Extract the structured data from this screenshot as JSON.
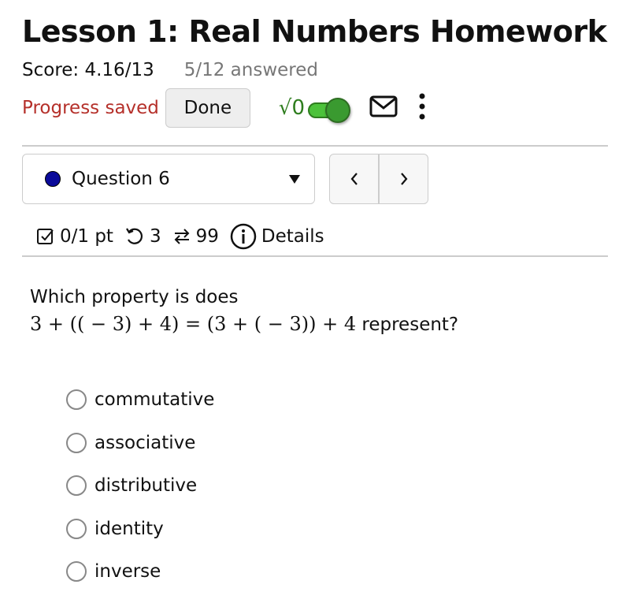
{
  "header": {
    "title": "Lesson 1: Real Numbers Homework",
    "score": "Score: 4.16/13",
    "answered": "5/12 answered",
    "progress_status": "Progress saved",
    "done_label": "Done",
    "math_toggle_label": "√0",
    "math_toggle_on": true
  },
  "question_nav": {
    "selected": "Question 6",
    "status_color": "#0a0a9a",
    "prev_label": "‹",
    "next_label": "›"
  },
  "meta": {
    "points": "0/1 pt",
    "retries": "3",
    "attempts": "99",
    "details_label": "Details"
  },
  "question": {
    "prompt": "Which property is does",
    "expression": "3 + (( − 3) + 4) = (3 + ( − 3)) + 4",
    "suffix": " represent?"
  },
  "options": [
    {
      "label": "commutative",
      "selected": false
    },
    {
      "label": "associative",
      "selected": false
    },
    {
      "label": "distributive",
      "selected": false
    },
    {
      "label": "identity",
      "selected": false
    },
    {
      "label": "inverse",
      "selected": false
    }
  ]
}
